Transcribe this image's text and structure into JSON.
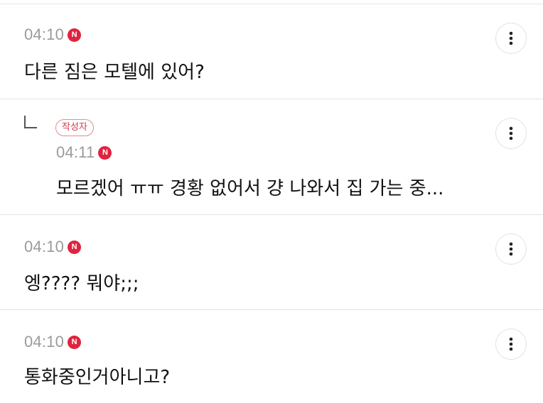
{
  "comments": [
    {
      "time": "04:10",
      "badge": "N",
      "text": "다른 짐은 모텔에 있어?"
    },
    {
      "author_badge": "작성자",
      "time": "04:11",
      "badge": "N",
      "text": "모르겠어 ㅠㅠ 경황 없어서 걍 나와서 집 가는 중..."
    },
    {
      "time": "04:10",
      "badge": "N",
      "text": "엥???? 뭐야;;;"
    },
    {
      "time": "04:10",
      "badge": "N",
      "text": "통화중인거아니고?"
    }
  ],
  "icons": {
    "more": "more-vertical-icon",
    "reply": "reply-arrow-icon"
  },
  "colors": {
    "badge": "#e0233e",
    "author_badge_border": "#e48a95",
    "author_badge_text": "#d1384a",
    "time": "#9a9a9a"
  }
}
